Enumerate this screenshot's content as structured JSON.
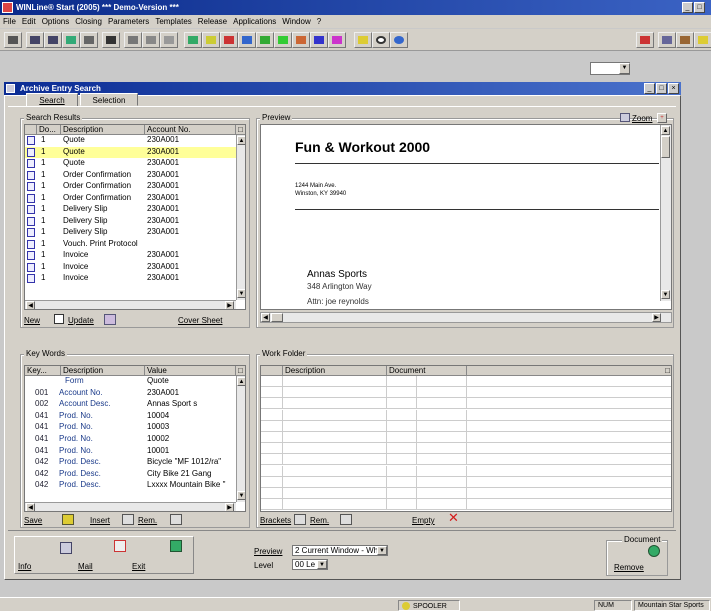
{
  "app": {
    "title": "WINLine® Start (2005) *** Demo-Version ***",
    "menu": [
      "File",
      "Edit",
      "Options",
      "Closing",
      "Parameters",
      "Templates",
      "Release",
      "Applications",
      "Window",
      "?"
    ]
  },
  "window": {
    "title": "Archive Entry Search",
    "tabs": [
      "Search",
      "Selection"
    ]
  },
  "search_results": {
    "label": "Search Results",
    "columns": [
      "Do...",
      "Description",
      "Account No."
    ],
    "rows": [
      {
        "doc": "1",
        "desc": "Quote",
        "acct": "230A001",
        "selected": false
      },
      {
        "doc": "1",
        "desc": "Quote",
        "acct": "230A001",
        "selected": true
      },
      {
        "doc": "1",
        "desc": "Quote",
        "acct": "230A001",
        "selected": false
      },
      {
        "doc": "1",
        "desc": "Order Confirmation",
        "acct": "230A001",
        "selected": false
      },
      {
        "doc": "1",
        "desc": "Order Confirmation",
        "acct": "230A001",
        "selected": false
      },
      {
        "doc": "1",
        "desc": "Order Confirmation",
        "acct": "230A001",
        "selected": false
      },
      {
        "doc": "1",
        "desc": "Delivery Slip",
        "acct": "230A001",
        "selected": false
      },
      {
        "doc": "1",
        "desc": "Delivery Slip",
        "acct": "230A001",
        "selected": false
      },
      {
        "doc": "1",
        "desc": "Delivery Slip",
        "acct": "230A001",
        "selected": false
      },
      {
        "doc": "1",
        "desc": "Vouch. Print Protocol",
        "acct": "",
        "selected": false
      },
      {
        "doc": "1",
        "desc": "Invoice",
        "acct": "230A001",
        "selected": false
      },
      {
        "doc": "1",
        "desc": "Invoice",
        "acct": "230A001",
        "selected": false
      },
      {
        "doc": "1",
        "desc": "Invoice",
        "acct": "230A001",
        "selected": false
      }
    ],
    "new_label": "New",
    "update_label": "Update",
    "cover_sheet_label": "Cover Sheet"
  },
  "preview": {
    "label": "Preview",
    "zoom_label": "Zoom",
    "heading": "Fun & Workout 2000",
    "addr1": "1244 Main Ave.",
    "addr2": "Winston, KY 39940",
    "recipient": "Annas Sports",
    "street": "348 Arlington Way",
    "attn": "Attn: joe reynolds"
  },
  "keywords": {
    "label": "Key Words",
    "columns": [
      "Key...",
      "Description",
      "Value"
    ],
    "rows": [
      {
        "key": "",
        "desc": "Form",
        "value": "Quote"
      },
      {
        "key": "001",
        "desc": "Account No.",
        "value": "230A001"
      },
      {
        "key": "002",
        "desc": "Account Desc.",
        "value": "Annas Sport s"
      },
      {
        "key": "041",
        "desc": "Prod. No.",
        "value": "10004"
      },
      {
        "key": "041",
        "desc": "Prod. No.",
        "value": "10003"
      },
      {
        "key": "041",
        "desc": "Prod. No.",
        "value": "10002"
      },
      {
        "key": "041",
        "desc": "Prod. No.",
        "value": "10001"
      },
      {
        "key": "042",
        "desc": "Prod. Desc.",
        "value": "Bicycle \"MF 1012/ra\""
      },
      {
        "key": "042",
        "desc": "Prod. Desc.",
        "value": "City Bike 21 Gang"
      },
      {
        "key": "042",
        "desc": "Prod. Desc.",
        "value": "Lxxxx Mountain Bike \""
      }
    ],
    "save_label": "Save",
    "insert_label": "Insert",
    "rem_label": "Rem."
  },
  "work_folder": {
    "label": "Work Folder",
    "columns": [
      "Description",
      "Document"
    ],
    "brackets_label": "Brackets",
    "rem_label": "Rem.",
    "empty_label": "Empty"
  },
  "bottom": {
    "info_label": "Info",
    "mail_label": "Mail",
    "exit_label": "Exit",
    "preview_label": "Preview",
    "preview_value": "2 Current Window - Whole Pa",
    "level_label": "Level",
    "level_value": "00 Le",
    "document_label": "Document",
    "remove_label": "Remove"
  },
  "status": {
    "spooler": "SPOOLER",
    "num": "NUM",
    "company": "Mountain Star Sports"
  },
  "colors": {
    "title_bar": "#0a2a8a",
    "selected_row": "#ffff99",
    "empty_x": "#d41a1a"
  }
}
